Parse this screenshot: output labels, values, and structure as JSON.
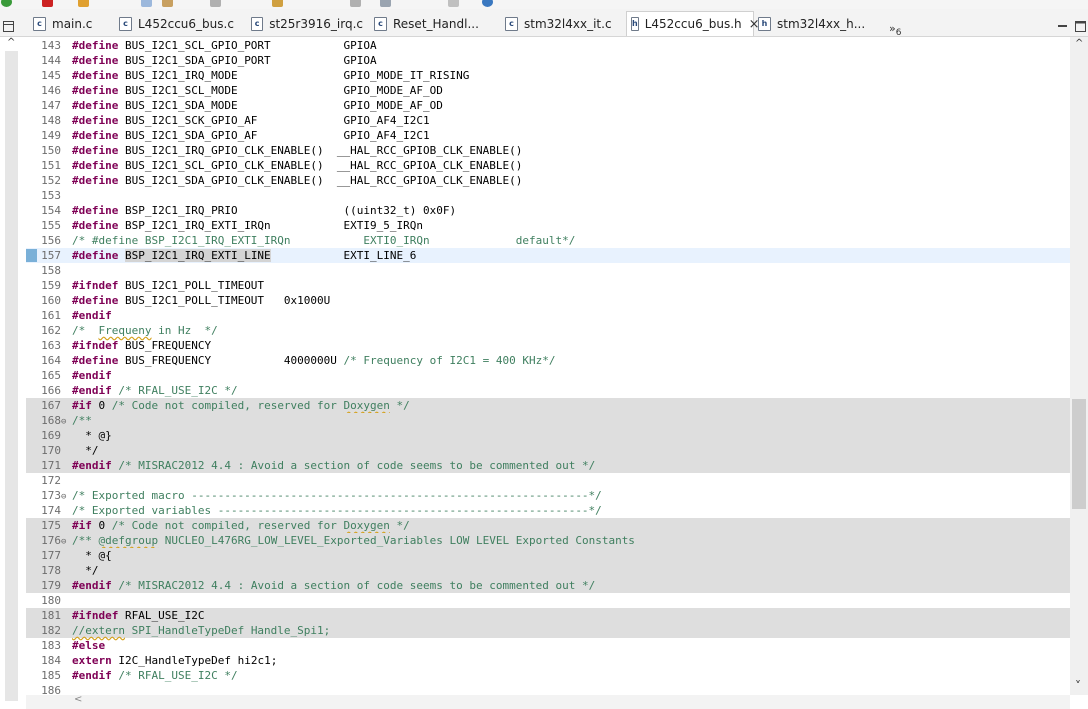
{
  "editor_tabs": [
    {
      "label": "main.c",
      "icon": "c-file-icon",
      "icon_char": "c"
    },
    {
      "label": "L452ccu6_bus.c",
      "icon": "c-file-icon",
      "icon_char": "c"
    },
    {
      "label": "st25r3916_irq.c",
      "icon": "c-file-icon",
      "icon_char": "c"
    },
    {
      "label": "Reset_Handl...",
      "icon": "c-file-icon",
      "icon_char": "c"
    },
    {
      "label": "stm32l4xx_it.c",
      "icon": "c-file-icon",
      "icon_char": "c"
    },
    {
      "label": "L452ccu6_bus.h",
      "icon": "h-file-icon",
      "icon_char": "h",
      "active": true,
      "close": "×"
    },
    {
      "label": "stm32l4xx_h...",
      "icon": "h-file-icon",
      "icon_char": "h"
    }
  ],
  "overflow": {
    "chevrons": "»",
    "count": "6"
  },
  "code_lines": [
    {
      "n": "143",
      "t": "#define BUS_I2C1_SCL_GPIO_PORT           GPIOA"
    },
    {
      "n": "144",
      "t": "#define BUS_I2C1_SDA_GPIO_PORT           GPIOA"
    },
    {
      "n": "145",
      "t": "#define BUS_I2C1_IRQ_MODE                GPIO_MODE_IT_RISING"
    },
    {
      "n": "146",
      "t": "#define BUS_I2C1_SCL_MODE                GPIO_MODE_AF_OD"
    },
    {
      "n": "147",
      "t": "#define BUS_I2C1_SDA_MODE                GPIO_MODE_AF_OD"
    },
    {
      "n": "148",
      "t": "#define BUS_I2C1_SCK_GPIO_AF             GPIO_AF4_I2C1"
    },
    {
      "n": "149",
      "t": "#define BUS_I2C1_SDA_GPIO_AF             GPIO_AF4_I2C1"
    },
    {
      "n": "150",
      "t": "#define BUS_I2C1_IRQ_GPIO_CLK_ENABLE()  __HAL_RCC_GPIOB_CLK_ENABLE()"
    },
    {
      "n": "151",
      "t": "#define BUS_I2C1_SCL_GPIO_CLK_ENABLE()  __HAL_RCC_GPIOA_CLK_ENABLE()"
    },
    {
      "n": "152",
      "t": "#define BUS_I2C1_SDA_GPIO_CLK_ENABLE()  __HAL_RCC_GPIOA_CLK_ENABLE()"
    },
    {
      "n": "153",
      "t": ""
    },
    {
      "n": "154",
      "t": "#define BSP_I2C1_IRQ_PRIO                ((uint32_t) 0x0F)"
    },
    {
      "n": "155",
      "t": "#define BSP_I2C1_IRQ_EXTI_IRQn           EXTI9_5_IRQn"
    },
    {
      "n": "156",
      "t": "/* #define BSP_I2C1_IRQ_EXTI_IRQn           EXTI0_IRQn             default*/"
    },
    {
      "n": "157",
      "t": "#define BSP_I2C1_IRQ_EXTI_LINE           EXTI_LINE_6",
      "current": true,
      "marker": true
    },
    {
      "n": "158",
      "t": ""
    },
    {
      "n": "159",
      "t": "#ifndef BUS_I2C1_POLL_TIMEOUT"
    },
    {
      "n": "160",
      "t": "#define BUS_I2C1_POLL_TIMEOUT   0x1000U"
    },
    {
      "n": "161",
      "t": "#endif"
    },
    {
      "n": "162",
      "t": "/*  Frequeny in Hz  */"
    },
    {
      "n": "163",
      "t": "#ifndef BUS_FREQUENCY"
    },
    {
      "n": "164",
      "t": "#define BUS_FREQUENCY           4000000U /* Frequency of I2C1 = 400 KHz*/"
    },
    {
      "n": "165",
      "t": "#endif"
    },
    {
      "n": "166",
      "t": "#endif /* RFAL_USE_I2C */"
    },
    {
      "n": "167",
      "t": "#if 0 /* Code not compiled, reserved for Doxygen */",
      "gray": true
    },
    {
      "n": "168",
      "t": "/**",
      "gray": true,
      "fold": "⊖"
    },
    {
      "n": "169",
      "t": "  * @}",
      "gray": true
    },
    {
      "n": "170",
      "t": "  */",
      "gray": true
    },
    {
      "n": "171",
      "t": "#endif /* MISRAC2012 4.4 : Avoid a section of code seems to be commented out */",
      "gray": true
    },
    {
      "n": "172",
      "t": ""
    },
    {
      "n": "173",
      "t": "/* Exported macro ------------------------------------------------------------*/",
      "fold": "⊖"
    },
    {
      "n": "174",
      "t": "/* Exported variables --------------------------------------------------------*/"
    },
    {
      "n": "175",
      "t": "#if 0 /* Code not compiled, reserved for Doxygen */",
      "gray": true
    },
    {
      "n": "176",
      "t": "/** @defgroup NUCLEO_L476RG_LOW_LEVEL_Exported_Variables LOW LEVEL Exported Constants",
      "gray": true,
      "fold": "⊖"
    },
    {
      "n": "177",
      "t": "  * @{",
      "gray": true
    },
    {
      "n": "178",
      "t": "  */",
      "gray": true
    },
    {
      "n": "179",
      "t": "#endif /* MISRAC2012 4.4 : Avoid a section of code seems to be commented out */",
      "gray": true
    },
    {
      "n": "180",
      "t": ""
    },
    {
      "n": "181",
      "t": "#ifndef RFAL_USE_I2C",
      "gray": true
    },
    {
      "n": "182",
      "t": "//extern SPI_HandleTypeDef Handle_Spi1;",
      "gray": true
    },
    {
      "n": "183",
      "t": "#else"
    },
    {
      "n": "184",
      "t": "extern I2C_HandleTypeDef hi2c1;"
    },
    {
      "n": "185",
      "t": "#endif /* RFAL_USE_I2C */"
    },
    {
      "n": "186",
      "t": ""
    }
  ],
  "scroll": {
    "up": "^",
    "down": "˅",
    "left": "<"
  },
  "colors": {
    "keyword": "#7f0055",
    "comment": "#3f7f5f",
    "gray_block": "#dedede",
    "current_line": "#e8f2fe"
  }
}
